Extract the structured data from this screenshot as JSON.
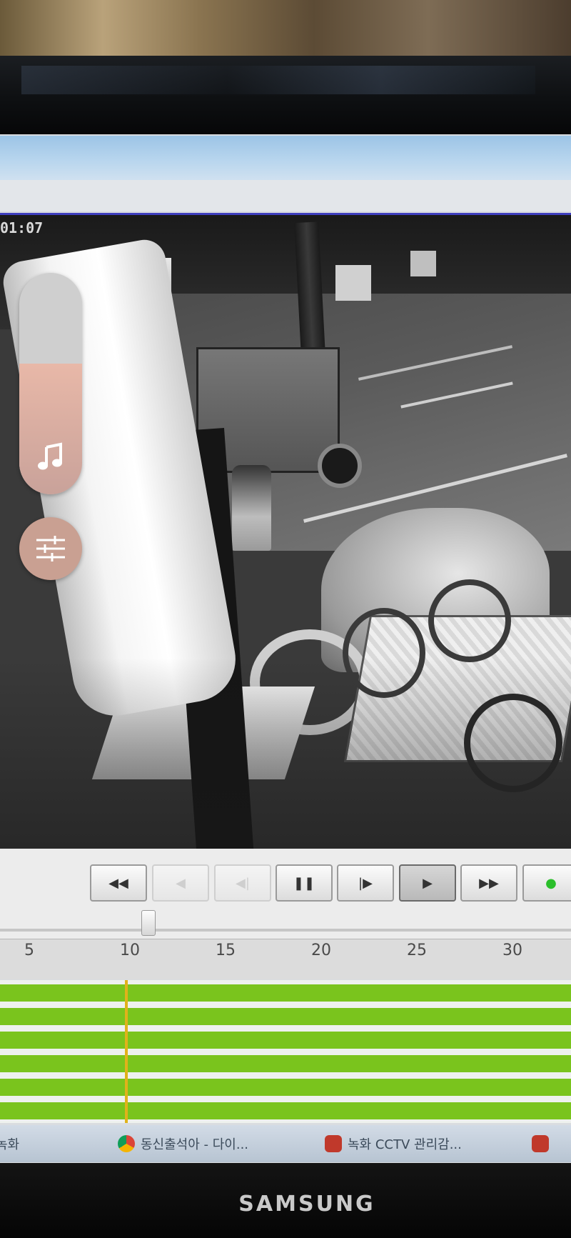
{
  "video": {
    "timestamp": "01:07"
  },
  "overlay": {
    "volume_level_percent": 59,
    "volume_icon": "music-note-icon",
    "equalizer_icon": "sliders-icon",
    "accent_color": "#c9a092"
  },
  "controls": {
    "buttons": [
      {
        "name": "rewind",
        "icon": "◀◀",
        "state": "enabled"
      },
      {
        "name": "reverse-play",
        "icon": "◀",
        "state": "disabled"
      },
      {
        "name": "step-back",
        "icon": "◀|",
        "state": "disabled"
      },
      {
        "name": "pause",
        "icon": "❚❚",
        "state": "enabled"
      },
      {
        "name": "step-forward",
        "icon": "|▶",
        "state": "enabled"
      },
      {
        "name": "play",
        "icon": "▶",
        "state": "active"
      },
      {
        "name": "fast-forward",
        "icon": "▶▶",
        "state": "enabled"
      },
      {
        "name": "record-indicator",
        "icon": "●",
        "state": "enabled"
      }
    ],
    "seek_position_fraction": 0.26
  },
  "timeline": {
    "ticks": [
      "5",
      "10",
      "15",
      "20",
      "25",
      "30"
    ],
    "record_color": "#7ac41d",
    "playhead_color": "#e0b21a",
    "playhead_minute": 11
  },
  "taskbar": {
    "items": [
      {
        "label": "녹화",
        "icon_color": "#6b7c8e"
      },
      {
        "label": "동신출석아 - 다이...",
        "icon_color": "#3b9b3b"
      },
      {
        "label": "녹화 CCTV 관리감...",
        "icon_color": "#c0392b"
      }
    ]
  },
  "monitor": {
    "brand": "SAMSUNG"
  }
}
